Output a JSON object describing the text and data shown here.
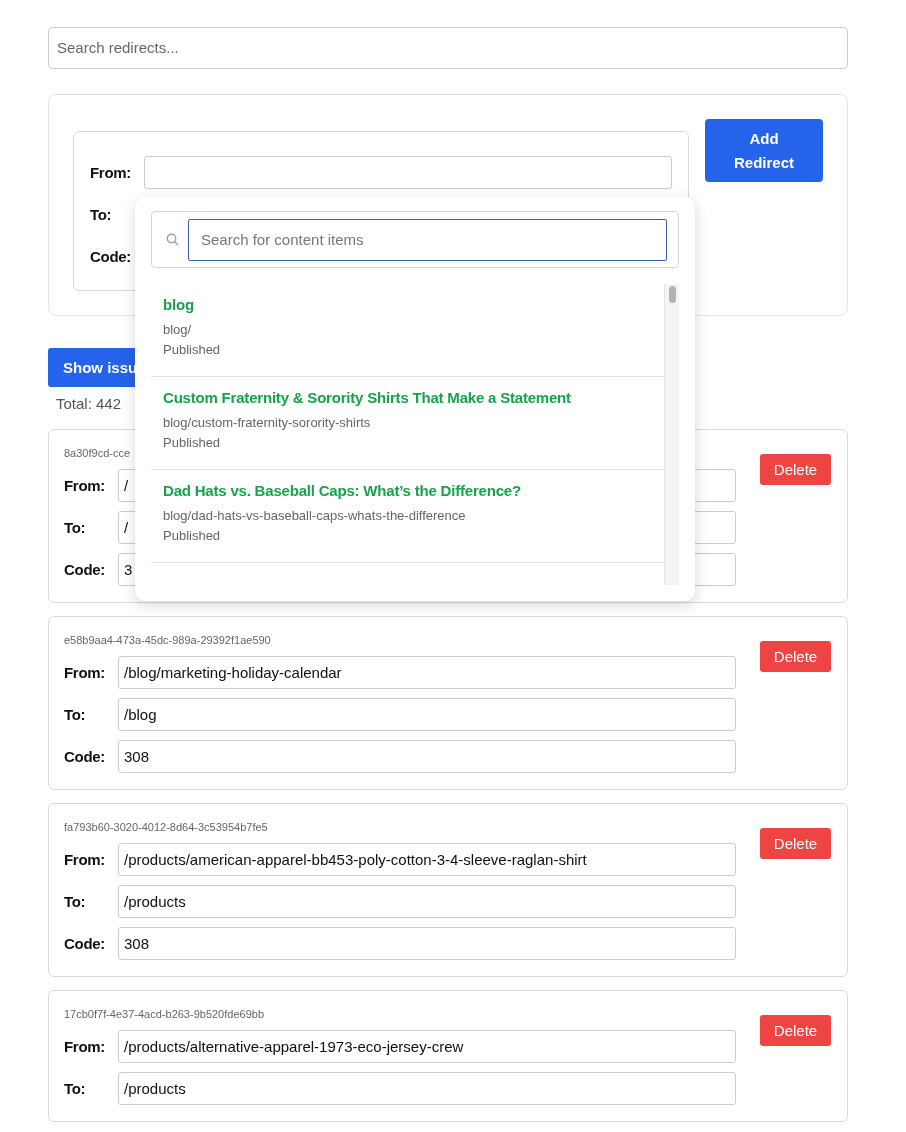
{
  "search": {
    "placeholder": "Search redirects..."
  },
  "add_form": {
    "fields": [
      {
        "label": "From:",
        "kind": "input"
      },
      {
        "label": "To:",
        "kind": "covered"
      },
      {
        "label": "Code:",
        "kind": "covered"
      }
    ],
    "button": "Add Redirect"
  },
  "picker": {
    "placeholder": "Search for content items",
    "items": [
      {
        "title": "blog",
        "path": "blog/",
        "status": "Published"
      },
      {
        "title": "Custom Fraternity & Sorority Shirts That Make a Statement",
        "path": "blog/custom-fraternity-sorority-shirts",
        "status": "Published"
      },
      {
        "title": "Dad Hats vs. Baseball Caps: What’s the Difference?",
        "path": "blog/dad-hats-vs-baseball-caps-whats-the-difference",
        "status": "Published"
      }
    ]
  },
  "show_issues_button": "Show issu",
  "total": "Total: 442",
  "redirects": [
    {
      "id": "8a30f9cd-cce",
      "from_label": "From:",
      "from": "/",
      "to_label": "To:",
      "to": "/",
      "code_label": "Code:",
      "code": "3",
      "delete": "Delete"
    },
    {
      "id": "e58b9aa4-473a-45dc-989a-29392f1ae590",
      "from_label": "From:",
      "from": "/blog/marketing-holiday-calendar",
      "to_label": "To:",
      "to": "/blog",
      "code_label": "Code:",
      "code": "308",
      "delete": "Delete"
    },
    {
      "id": "fa793b60-3020-4012-8d64-3c53954b7fe5",
      "from_label": "From:",
      "from": "/products/american-apparel-bb453-poly-cotton-3-4-sleeve-raglan-shirt",
      "to_label": "To:",
      "to": "/products",
      "code_label": "Code:",
      "code": "308",
      "delete": "Delete"
    },
    {
      "id": "17cb0f7f-4e37-4acd-b263-9b520fde69bb",
      "from_label": "From:",
      "from": "/products/alternative-apparel-1973-eco-jersey-crew",
      "to_label": "To:",
      "to": "/products",
      "delete": "Delete"
    }
  ]
}
